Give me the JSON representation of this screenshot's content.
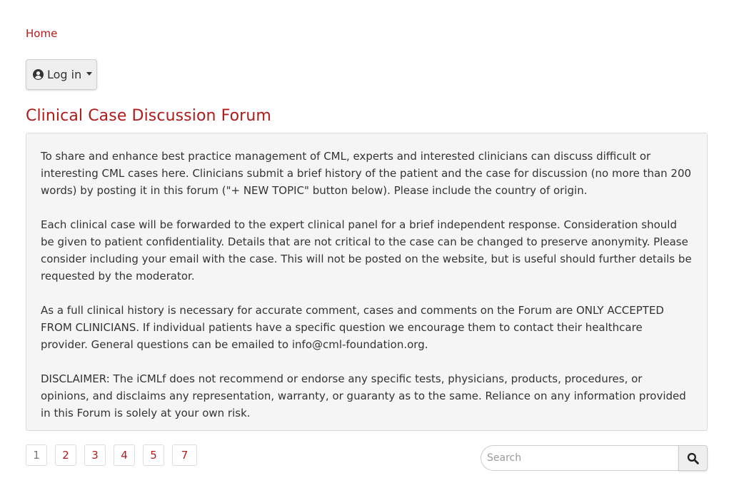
{
  "breadcrumb": {
    "home": "Home"
  },
  "login": {
    "icon": "user-circle-icon",
    "label": "Log in",
    "caret_icon": "caret-down-icon"
  },
  "forum": {
    "title": "Clinical Case Discussion Forum",
    "paragraphs": [
      "To share and enhance best practice management of CML, experts and interested clinicians can discuss difficult or interesting CML cases here. Clinicians submit a brief history of the patient and the case for discussion (no more than 200 words) by posting it in this forum (\"+ NEW TOPIC\" button below). Please include the country of origin.",
      "Each clinical case will be forwarded to the expert clinical panel for a brief independent response. Consideration should be given to patient confidentiality. Details that are not critical to the case can be changed to preserve anonymity. Please consider including your email with the case. This will not be posted on the website, but is useful should further details be requested by the moderator.",
      "As a full clinical history is necessary for accurate comment, cases and comments on the Forum are ONLY ACCEPTED FROM CLINICIANS. If individual patients have a specific question we encourage them to contact their healthcare provider. General questions can be emailed to info@cml-foundation.org.",
      "DISCLAIMER: The iCMLf does not recommend or endorse any specific tests, physicians, products, procedures, or opinions, and disclaims any representation, warranty, or guaranty as to the same. Reliance on any information provided in this Forum is solely at your own risk."
    ]
  },
  "pagination": {
    "pages": [
      "1",
      "2",
      "3",
      "4",
      "5",
      "7"
    ],
    "current": "1"
  },
  "search": {
    "placeholder": "Search",
    "value": "",
    "icon": "search-icon"
  },
  "colors": {
    "accent": "#b01c1c",
    "text": "#333333",
    "box_background": "#f5f5f5"
  }
}
